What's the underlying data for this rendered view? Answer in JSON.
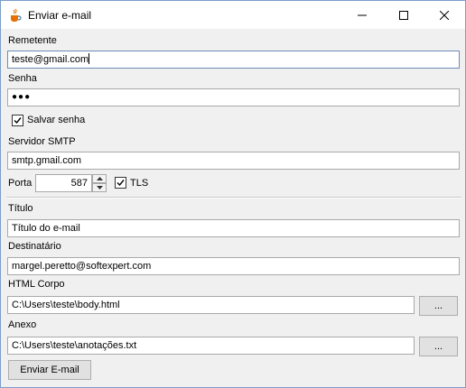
{
  "window": {
    "title": "Enviar e-mail",
    "icon": "java-cup-icon",
    "controls": [
      "minimize-icon",
      "maximize-icon",
      "close-icon"
    ]
  },
  "sender": {
    "label": "Remetente",
    "value": "teste@gmail.com"
  },
  "password": {
    "label": "Senha",
    "value": "●●●"
  },
  "save_password": {
    "label": "Salvar senha",
    "checked": true
  },
  "smtp_server": {
    "label": "Servidor SMTP",
    "value": "smtp.gmail.com"
  },
  "port": {
    "label": "Porta",
    "value": "587"
  },
  "tls": {
    "label": "TLS",
    "checked": true
  },
  "subject": {
    "label": "Título",
    "value": "Título do e-mail"
  },
  "recipient": {
    "label": "Destinatário",
    "value": "margel.peretto@softexpert.com"
  },
  "html_body": {
    "label": "HTML Corpo",
    "value": "C:\\Users\\teste\\body.html",
    "browse_label": "..."
  },
  "attachment": {
    "label": "Anexo",
    "value": "C:\\Users\\teste\\anotações.txt",
    "browse_label": "..."
  },
  "send_button": {
    "label": "Enviar E-mail"
  }
}
